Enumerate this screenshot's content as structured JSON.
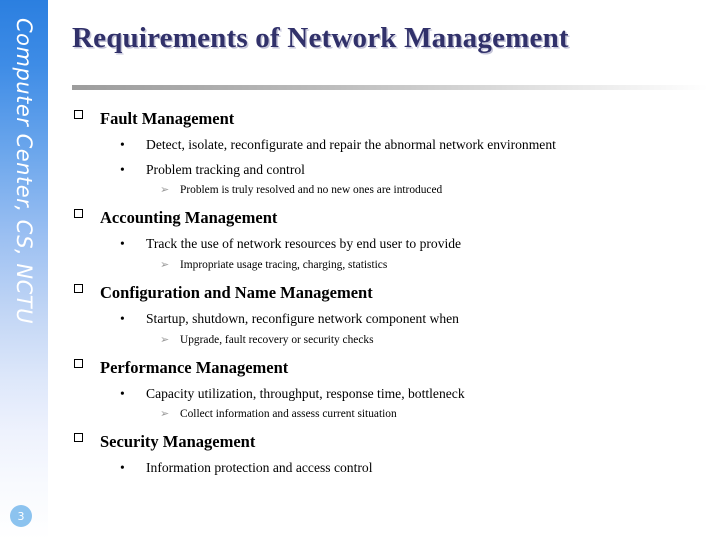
{
  "slide": {
    "title": "Requirements of Network Management",
    "page_number": "3",
    "sidebar_label": "Computer Center, CS, NCTU",
    "colors": {
      "title": "#31316a",
      "sidebar_top": "#2b7fe0",
      "sidebar_bottom": "#ffffff",
      "page_badge": "#8cc3ef",
      "arrow_bullet": "#9a9a9a"
    },
    "bullets": {
      "level1_icon": "hollow-square-bullet",
      "level2_icon": "round-dot-bullet",
      "level3_icon": "gray-arrowhead-bullet",
      "level2_glyph": "•",
      "level3_glyph": "➢"
    },
    "outline": [
      {
        "level": 1,
        "text": "Fault Management"
      },
      {
        "level": 2,
        "text": "Detect, isolate, reconfigurate and repair the abnormal network environment"
      },
      {
        "level": 2,
        "text": "Problem tracking and control"
      },
      {
        "level": 3,
        "text": "Problem is truly resolved and no new ones are introduced"
      },
      {
        "level": 1,
        "text": "Accounting Management"
      },
      {
        "level": 2,
        "text": "Track the use of network resources by end user to provide"
      },
      {
        "level": 3,
        "text": "Impropriate usage tracing, charging, statistics"
      },
      {
        "level": 1,
        "text": "Configuration and Name Management"
      },
      {
        "level": 2,
        "text": "Startup, shutdown, reconfigure network component when"
      },
      {
        "level": 3,
        "text": "Upgrade, fault recovery or security checks"
      },
      {
        "level": 1,
        "text": "Performance Management"
      },
      {
        "level": 2,
        "text": "Capacity utilization, throughput, response time,  bottleneck"
      },
      {
        "level": 3,
        "text": "Collect information and assess current situation"
      },
      {
        "level": 1,
        "text": "Security Management"
      },
      {
        "level": 2,
        "text": "Information protection and access control"
      }
    ]
  }
}
